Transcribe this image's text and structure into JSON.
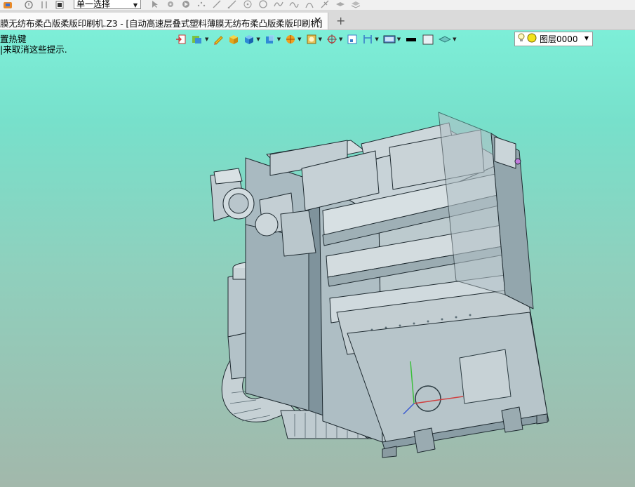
{
  "quick_toolbar": {
    "selection_mode": "单一选择",
    "icons": [
      "app-menu-icon",
      "filter-icon",
      "pick-icon",
      "stop-icon",
      "cursor-icon",
      "gear-icon",
      "play-icon",
      "points-icon",
      "line-icon",
      "draw-line-icon",
      "circle-point-icon",
      "circle-icon",
      "spline-icon",
      "curve-icon",
      "arc-icon",
      "trim-icon",
      "layers-icon",
      "stack-icon"
    ]
  },
  "tabs": {
    "document_title": "膜无纺布柔凸版柔版印刷机.Z3 - [自动高速层叠式塑料薄膜无纺布柔凸版柔版印刷机]",
    "close_symbol": "✕",
    "new_tab_symbol": "+"
  },
  "prompt": {
    "line1": "置热键",
    "line2": "|来取消这些提示."
  },
  "graphics_toolbar": {
    "icons": [
      "exit-icon",
      "display-style-icon",
      "pencil-icon",
      "shaded-box-icon",
      "blue-cube-icon",
      "view-cube-icon",
      "render-ball-icon",
      "texture-icon",
      "orient-icon",
      "window-zoom-icon",
      "section-icon",
      "screen-icon",
      "black-rect-icon",
      "white-rect-icon",
      "layer-stack-icon"
    ]
  },
  "layer": {
    "name": "图层0000"
  },
  "colors": {
    "background_top": "#7ff3dc",
    "background_bottom": "#a2b8ab",
    "machine_body": "#b7c8cf",
    "machine_dark": "#5f7580"
  }
}
